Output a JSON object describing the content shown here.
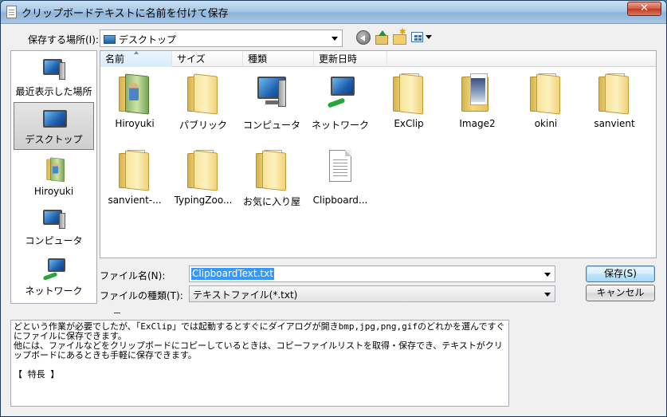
{
  "window": {
    "title": "クリップボードテキストに名前を付けて保存",
    "close_label": "✕"
  },
  "save_in": {
    "label": "保存する場所(I):",
    "value": "デスクトップ"
  },
  "toolbar": {
    "back_icon": "back-icon",
    "up_icon": "up-one-level-icon",
    "new_folder_icon": "new-folder-icon",
    "views_icon": "view-menu-icon"
  },
  "places": [
    {
      "label": "最近表示した場所",
      "icon": "recent-places-icon",
      "selected": false
    },
    {
      "label": "デスクトップ",
      "icon": "desktop-icon",
      "selected": true
    },
    {
      "label": "Hiroyuki",
      "icon": "user-folder-icon",
      "selected": false
    },
    {
      "label": "コンピュータ",
      "icon": "computer-icon",
      "selected": false
    },
    {
      "label": "ネットワーク",
      "icon": "network-icon",
      "selected": false
    }
  ],
  "columns": [
    "名前",
    "サイズ",
    "種類",
    "更新日時"
  ],
  "files": [
    {
      "name": "Hiroyuki",
      "icon": "user-folder-icon"
    },
    {
      "name": "パブリック",
      "icon": "folder-icon"
    },
    {
      "name": "コンピュータ",
      "icon": "computer-icon"
    },
    {
      "name": "ネットワーク",
      "icon": "network-icon"
    },
    {
      "name": "ExClip",
      "icon": "folder-icon"
    },
    {
      "name": "Image2",
      "icon": "image-folder-icon"
    },
    {
      "name": "okini",
      "icon": "folder-icon"
    },
    {
      "name": "sanvient",
      "icon": "folder-icon"
    },
    {
      "name": "sanvient-...",
      "icon": "folder-icon"
    },
    {
      "name": "TypingZoo...",
      "icon": "folder-icon"
    },
    {
      "name": "お気に入り屋",
      "icon": "folder-icon"
    },
    {
      "name": "Clipboard...",
      "icon": "text-file-icon"
    }
  ],
  "filename": {
    "label": "ファイル名(N):",
    "value": "ClipboardText.txt"
  },
  "filetype": {
    "label": "ファイルの種類(T):",
    "value": "テキストファイル(*.txt)"
  },
  "buttons": {
    "save": "保存(S)",
    "cancel": "キャンセル"
  },
  "preview_text": "どという作業が必要でしたが、「ExClip」では起動するとすぐにダイアログが開きbmp,jpg,png,gifのどれかを選んですぐにファイルに保存できます。\n他には、ファイルなどをクリップボードにコピーしているときは、コピーファイルリストを取得・保存でき、テキストがクリップボードにあるときも手軽に保存できます。\n\n【 特長 】"
}
